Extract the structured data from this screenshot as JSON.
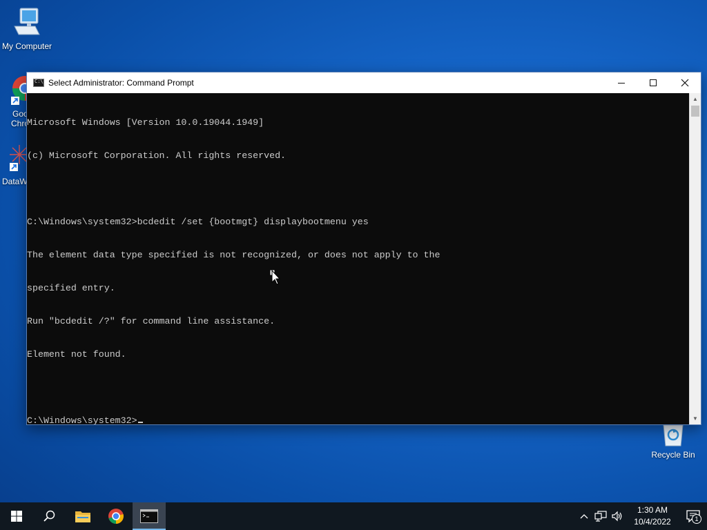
{
  "desktop": {
    "icons": [
      {
        "label": "My Computer",
        "icon": "computer-icon"
      },
      {
        "label": "Recycle Bin",
        "icon": "recycle-bin-icon"
      }
    ],
    "partial_icons": [
      {
        "label_line1": "Goo",
        "label_line2": "Chro",
        "icon": "chrome-icon"
      },
      {
        "label_line1": "DataW",
        "icon": "datawrapper-icon"
      }
    ]
  },
  "window": {
    "title": "Select Administrator: Command Prompt",
    "console_lines": [
      "Microsoft Windows [Version 10.0.19044.1949]",
      "(c) Microsoft Corporation. All rights reserved.",
      "",
      "C:\\Windows\\system32>bcdedit /set {bootmgt} displaybootmenu yes",
      "The element data type specified is not recognized, or does not apply to the",
      "specified entry.",
      "Run \"bcdedit /?\" for command line assistance.",
      "Element not found.",
      ""
    ],
    "prompt": "C:\\Windows\\system32>"
  },
  "taskbar": {
    "items": [
      {
        "name": "start-button",
        "icon": "windows-icon"
      },
      {
        "name": "search-button",
        "icon": "search-icon"
      },
      {
        "name": "file-explorer-button",
        "icon": "folder-icon"
      },
      {
        "name": "chrome-button",
        "icon": "chrome-icon"
      },
      {
        "name": "command-prompt-button",
        "icon": "cmd-icon",
        "active": true
      }
    ],
    "clock": {
      "time": "1:30 AM",
      "date": "10/4/2022"
    },
    "notification_count": "1"
  },
  "colors": {
    "console_bg": "#0c0c0c",
    "console_text": "#cccccc",
    "taskbar_bg": "#101820",
    "accent": "#76b9ed"
  }
}
